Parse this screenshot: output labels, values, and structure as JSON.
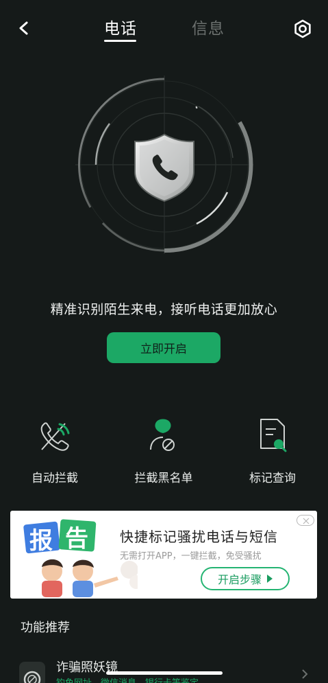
{
  "header": {
    "tabs": [
      {
        "label": "电话",
        "active": true
      },
      {
        "label": "信息",
        "active": false
      }
    ]
  },
  "hero": {
    "tagline": "精准识别陌生来电，接听电话更加放心",
    "enable_button": "立即开启"
  },
  "features": [
    {
      "label": "自动拦截",
      "icon": "phone-block-icon"
    },
    {
      "label": "拦截黑名单",
      "icon": "blacklist-icon"
    },
    {
      "label": "标记查询",
      "icon": "mark-query-icon"
    }
  ],
  "ad": {
    "art_text_1": "报",
    "art_text_2": "告",
    "title": "快捷标记骚扰电话与短信",
    "subtitle": "无需打开APP，一键拦截，免受骚扰",
    "button": "开启步骤"
  },
  "recommend": {
    "section_title": "功能推荐",
    "items": [
      {
        "title": "诈骗照妖镜",
        "subtitle": "钓鱼网址、微信消息、银行卡等鉴定"
      }
    ]
  },
  "colors": {
    "background": "#151a19",
    "accent": "#1ca865",
    "text": "#e9ecea",
    "inactive_tab": "#6c716f"
  }
}
